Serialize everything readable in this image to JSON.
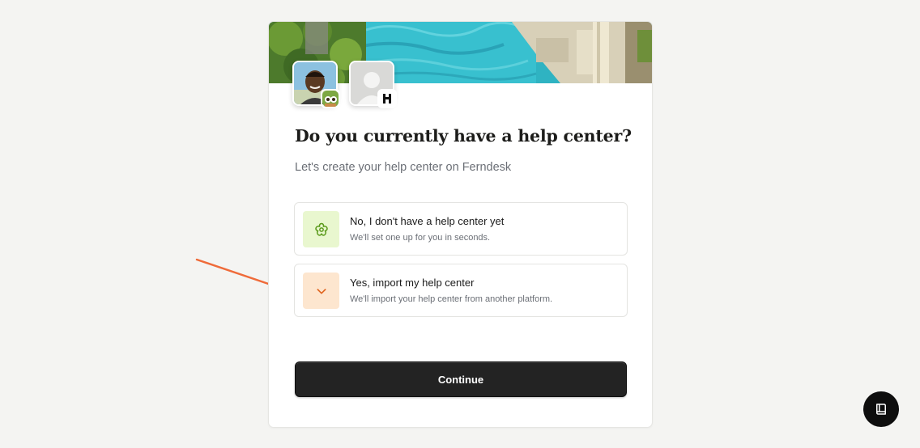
{
  "heading": "Do you currently have a help center?",
  "subheading": "Let's create your help center on Ferndesk",
  "options": [
    {
      "title": "No, I don't have a help center yet",
      "description": "We'll set one up for you in seconds.",
      "icon": "flower-icon",
      "icon_bg": "#e9f7cf",
      "icon_color": "#5a9a1a"
    },
    {
      "title": "Yes, import my help center",
      "description": "We'll import your help center from another platform.",
      "icon": "chevron-down-icon",
      "icon_bg": "#fde6cf",
      "icon_color": "#e0641e"
    }
  ],
  "continue_label": "Continue",
  "colors": {
    "annotation_arrow": "#ef6b3a",
    "button_bg": "#232323",
    "page_bg": "#f4f4f2"
  }
}
